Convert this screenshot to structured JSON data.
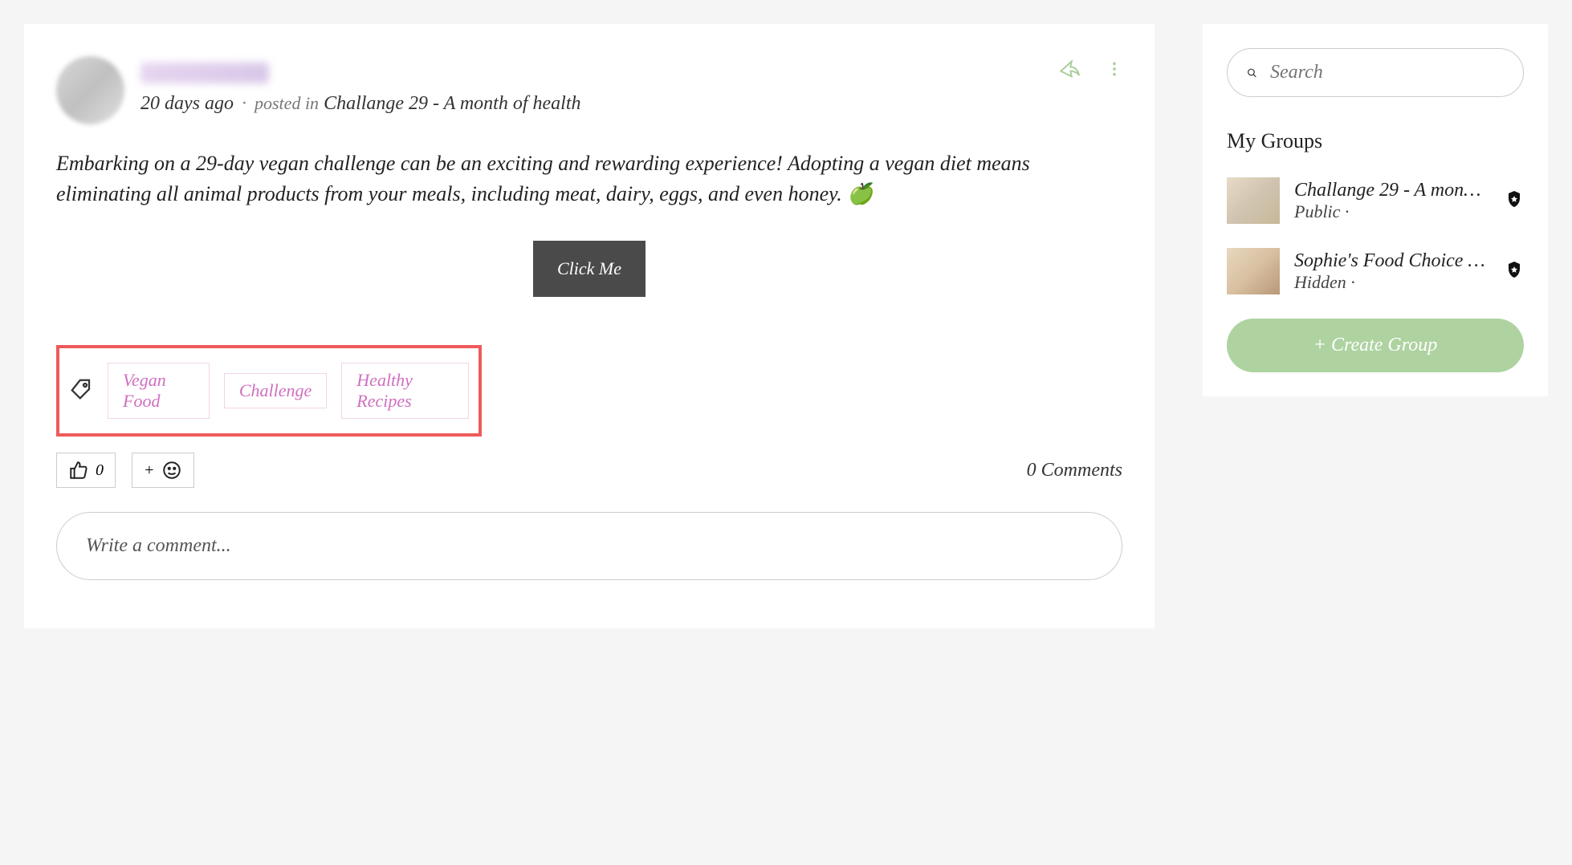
{
  "post": {
    "meta": {
      "time": "20 days ago",
      "posted_in_label": "posted in",
      "group_name": "Challange 29 - A month of health"
    },
    "body": "Embarking on a 29-day vegan challenge can be an exciting and rewarding experience! Adopting a vegan diet means eliminating all animal products from your meals, including meat, dairy, eggs, and even honey. 🍏",
    "cta_label": "Click Me",
    "tags": [
      "Vegan Food",
      "Challenge",
      "Healthy Recipes"
    ],
    "reactions": {
      "like_count": "0",
      "add_label": "+"
    },
    "comment_count": "0 Comments",
    "comment_placeholder": "Write a comment..."
  },
  "sidebar": {
    "search_placeholder": "Search",
    "groups_title": "My Groups",
    "groups": [
      {
        "name": "Challange 29 - A mon…",
        "visibility": "Public ·"
      },
      {
        "name": "Sophie's Food Choice …",
        "visibility": "Hidden ·"
      }
    ],
    "create_group_label": "+ Create Group"
  }
}
